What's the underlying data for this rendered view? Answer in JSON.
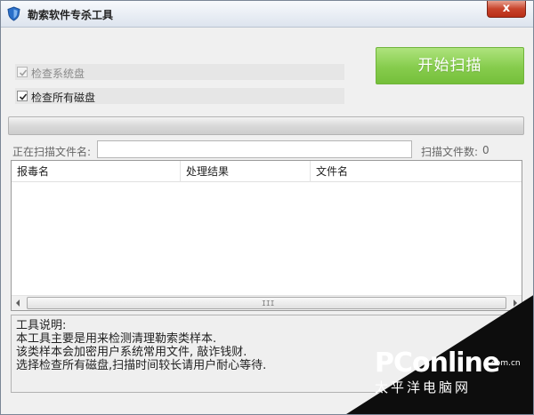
{
  "window": {
    "title": "勒索软件专杀工具",
    "close_label": "x"
  },
  "options": {
    "check_system_disk": {
      "label": "检查系统盘",
      "checked": true,
      "disabled": true
    },
    "check_all_disks": {
      "label": "检查所有磁盘",
      "checked": true,
      "disabled": false
    }
  },
  "start_button": {
    "label": "开始扫描"
  },
  "progress": {
    "value": 0
  },
  "scan": {
    "file_label": "正在扫描文件名:",
    "file_value": "",
    "count_label": "扫描文件数:",
    "count_value": "0"
  },
  "results_table": {
    "columns": [
      "报毒名",
      "处理结果",
      "文件名"
    ],
    "rows": [],
    "scroll_grip": "III"
  },
  "description": {
    "lines": [
      "工具说明:",
      "本工具主要是用来检测清理勒索类样本.",
      "该类样本会加密用户系统常用文件, 敲诈钱财.",
      "选择检查所有磁盘,扫描时间较长请用户耐心等待."
    ]
  },
  "watermark": {
    "logo": "PConline",
    "domain": ".com.cn",
    "subtitle": "太平洋电脑网"
  },
  "colors": {
    "accent_green": "#86cc4d",
    "close_red": "#c7432b"
  }
}
